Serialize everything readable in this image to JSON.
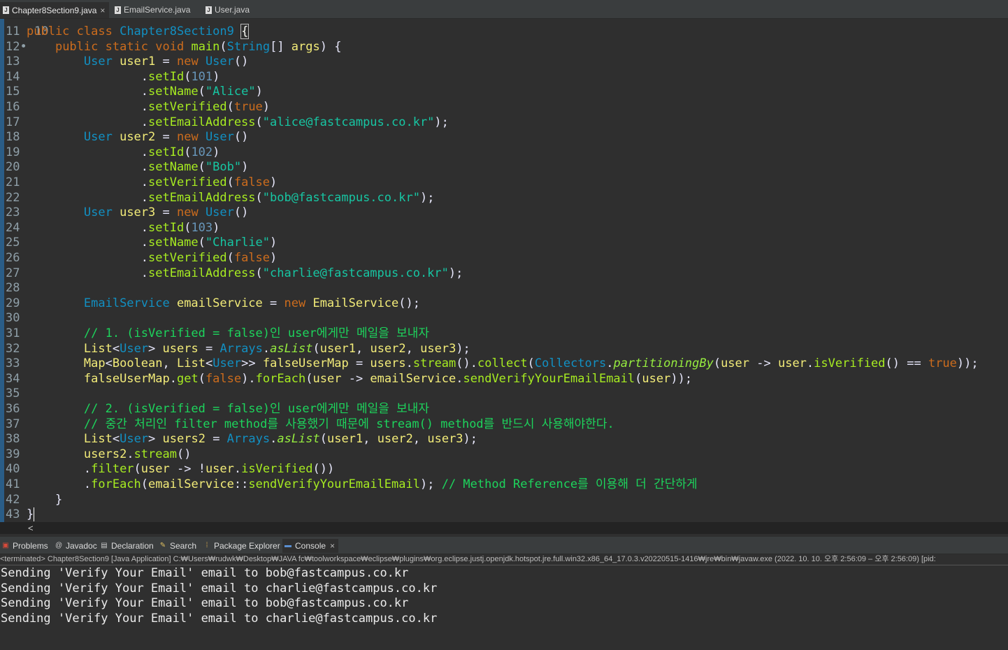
{
  "editor_tabs": [
    {
      "label": "Chapter8Section9.java",
      "active": true,
      "closable": true
    },
    {
      "label": "EmailService.java",
      "active": false
    },
    {
      "label": "User.java",
      "active": false
    }
  ],
  "editor": {
    "partial_top_line": "10",
    "lines": [
      {
        "num": "11",
        "segments": [
          [
            "k",
            "public "
          ],
          [
            "k",
            "class "
          ],
          [
            "t",
            "Chapter8Section9 "
          ],
          [
            "bracket",
            "{"
          ]
        ]
      },
      {
        "num": "12",
        "marker": "•",
        "segments": [
          [
            "p",
            "    "
          ],
          [
            "k",
            "public "
          ],
          [
            "k",
            "static "
          ],
          [
            "k",
            "void "
          ],
          [
            "m",
            "main"
          ],
          [
            "p",
            "("
          ],
          [
            "t",
            "String"
          ],
          [
            "p",
            "[] "
          ],
          [
            "v",
            "args"
          ],
          [
            "p",
            ") {"
          ]
        ]
      },
      {
        "num": "13",
        "segments": [
          [
            "p",
            "        "
          ],
          [
            "t",
            "User "
          ],
          [
            "v",
            "user1"
          ],
          [
            "p",
            " = "
          ],
          [
            "k",
            "new "
          ],
          [
            "t",
            "User"
          ],
          [
            "p",
            "()"
          ]
        ]
      },
      {
        "num": "14",
        "segments": [
          [
            "p",
            "                ."
          ],
          [
            "m",
            "setId"
          ],
          [
            "p",
            "("
          ],
          [
            "n",
            "101"
          ],
          [
            "p",
            ")"
          ]
        ]
      },
      {
        "num": "15",
        "segments": [
          [
            "p",
            "                ."
          ],
          [
            "m",
            "setName"
          ],
          [
            "p",
            "("
          ],
          [
            "s",
            "\"Alice\""
          ],
          [
            "p",
            ")"
          ]
        ]
      },
      {
        "num": "16",
        "segments": [
          [
            "p",
            "                ."
          ],
          [
            "m",
            "setVerified"
          ],
          [
            "p",
            "("
          ],
          [
            "k",
            "true"
          ],
          [
            "p",
            ")"
          ]
        ]
      },
      {
        "num": "17",
        "segments": [
          [
            "p",
            "                ."
          ],
          [
            "m",
            "setEmailAddress"
          ],
          [
            "p",
            "("
          ],
          [
            "s",
            "\"alice@fastcampus.co.kr\""
          ],
          [
            "p",
            ");"
          ]
        ]
      },
      {
        "num": "18",
        "segments": [
          [
            "p",
            "        "
          ],
          [
            "t",
            "User "
          ],
          [
            "v",
            "user2"
          ],
          [
            "p",
            " = "
          ],
          [
            "k",
            "new "
          ],
          [
            "t",
            "User"
          ],
          [
            "p",
            "()"
          ]
        ]
      },
      {
        "num": "19",
        "segments": [
          [
            "p",
            "                ."
          ],
          [
            "m",
            "setId"
          ],
          [
            "p",
            "("
          ],
          [
            "n",
            "102"
          ],
          [
            "p",
            ")"
          ]
        ]
      },
      {
        "num": "20",
        "segments": [
          [
            "p",
            "                ."
          ],
          [
            "m",
            "setName"
          ],
          [
            "p",
            "("
          ],
          [
            "s",
            "\"Bob\""
          ],
          [
            "p",
            ")"
          ]
        ]
      },
      {
        "num": "21",
        "segments": [
          [
            "p",
            "                ."
          ],
          [
            "m",
            "setVerified"
          ],
          [
            "p",
            "("
          ],
          [
            "k",
            "false"
          ],
          [
            "p",
            ")"
          ]
        ]
      },
      {
        "num": "22",
        "segments": [
          [
            "p",
            "                ."
          ],
          [
            "m",
            "setEmailAddress"
          ],
          [
            "p",
            "("
          ],
          [
            "s",
            "\"bob@fastcampus.co.kr\""
          ],
          [
            "p",
            ");"
          ]
        ]
      },
      {
        "num": "23",
        "segments": [
          [
            "p",
            "        "
          ],
          [
            "t",
            "User "
          ],
          [
            "v",
            "user3"
          ],
          [
            "p",
            " = "
          ],
          [
            "k",
            "new "
          ],
          [
            "t",
            "User"
          ],
          [
            "p",
            "()"
          ]
        ]
      },
      {
        "num": "24",
        "segments": [
          [
            "p",
            "                ."
          ],
          [
            "m",
            "setId"
          ],
          [
            "p",
            "("
          ],
          [
            "n",
            "103"
          ],
          [
            "p",
            ")"
          ]
        ]
      },
      {
        "num": "25",
        "segments": [
          [
            "p",
            "                ."
          ],
          [
            "m",
            "setName"
          ],
          [
            "p",
            "("
          ],
          [
            "s",
            "\"Charlie\""
          ],
          [
            "p",
            ")"
          ]
        ]
      },
      {
        "num": "26",
        "segments": [
          [
            "p",
            "                ."
          ],
          [
            "m",
            "setVerified"
          ],
          [
            "p",
            "("
          ],
          [
            "k",
            "false"
          ],
          [
            "p",
            ")"
          ]
        ]
      },
      {
        "num": "27",
        "segments": [
          [
            "p",
            "                ."
          ],
          [
            "m",
            "setEmailAddress"
          ],
          [
            "p",
            "("
          ],
          [
            "s",
            "\"charlie@fastcampus.co.kr\""
          ],
          [
            "p",
            ");"
          ]
        ]
      },
      {
        "num": "28",
        "segments": []
      },
      {
        "num": "29",
        "segments": [
          [
            "p",
            "        "
          ],
          [
            "t",
            "EmailService "
          ],
          [
            "v",
            "emailService"
          ],
          [
            "p",
            " = "
          ],
          [
            "k",
            "new "
          ],
          [
            "v",
            "EmailService"
          ],
          [
            "p",
            "();"
          ]
        ]
      },
      {
        "num": "30",
        "segments": []
      },
      {
        "num": "31",
        "segments": [
          [
            "p",
            "        "
          ],
          [
            "c",
            "// 1. (isVerified = false)인 user에게만 메일을 보내자"
          ]
        ]
      },
      {
        "num": "32",
        "segments": [
          [
            "p",
            "        "
          ],
          [
            "v",
            "List"
          ],
          [
            "p",
            "<"
          ],
          [
            "t",
            "User"
          ],
          [
            "p",
            "> "
          ],
          [
            "v",
            "users"
          ],
          [
            "p",
            " = "
          ],
          [
            "t",
            "Arrays"
          ],
          [
            "p",
            "."
          ],
          [
            "st",
            "asList"
          ],
          [
            "p",
            "("
          ],
          [
            "v",
            "user1"
          ],
          [
            "p",
            ", "
          ],
          [
            "v",
            "user2"
          ],
          [
            "p",
            ", "
          ],
          [
            "v",
            "user3"
          ],
          [
            "p",
            ");"
          ]
        ]
      },
      {
        "num": "33",
        "segments": [
          [
            "p",
            "        "
          ],
          [
            "v",
            "Map"
          ],
          [
            "p",
            "<"
          ],
          [
            "v",
            "Boolean"
          ],
          [
            "p",
            ", "
          ],
          [
            "v",
            "List"
          ],
          [
            "p",
            "<"
          ],
          [
            "t",
            "User"
          ],
          [
            "p",
            ">> "
          ],
          [
            "v",
            "falseUserMap"
          ],
          [
            "p",
            " = "
          ],
          [
            "v",
            "users"
          ],
          [
            "p",
            "."
          ],
          [
            "m",
            "stream"
          ],
          [
            "p",
            "()."
          ],
          [
            "m",
            "collect"
          ],
          [
            "p",
            "("
          ],
          [
            "t",
            "Collectors"
          ],
          [
            "p",
            "."
          ],
          [
            "st",
            "partitioningBy"
          ],
          [
            "p",
            "("
          ],
          [
            "v",
            "user"
          ],
          [
            "p",
            " -> "
          ],
          [
            "v",
            "user"
          ],
          [
            "p",
            "."
          ],
          [
            "m",
            "isVerified"
          ],
          [
            "p",
            "() == "
          ],
          [
            "k",
            "true"
          ],
          [
            "p",
            "));"
          ]
        ]
      },
      {
        "num": "34",
        "segments": [
          [
            "p",
            "        "
          ],
          [
            "v",
            "falseUserMap"
          ],
          [
            "p",
            "."
          ],
          [
            "m",
            "get"
          ],
          [
            "p",
            "("
          ],
          [
            "k",
            "false"
          ],
          [
            "p",
            ")."
          ],
          [
            "m",
            "forEach"
          ],
          [
            "p",
            "("
          ],
          [
            "v",
            "user"
          ],
          [
            "p",
            " -> "
          ],
          [
            "v",
            "emailService"
          ],
          [
            "p",
            "."
          ],
          [
            "m",
            "sendVerifyYourEmailEmail"
          ],
          [
            "p",
            "("
          ],
          [
            "v",
            "user"
          ],
          [
            "p",
            "));"
          ]
        ]
      },
      {
        "num": "35",
        "segments": []
      },
      {
        "num": "36",
        "segments": [
          [
            "p",
            "        "
          ],
          [
            "c",
            "// 2. (isVerified = false)인 user에게만 메일을 보내자"
          ]
        ]
      },
      {
        "num": "37",
        "segments": [
          [
            "p",
            "        "
          ],
          [
            "c",
            "// 중간 처리인 filter method를 사용했기 때문에 stream() method를 반드시 사용해야한다."
          ]
        ]
      },
      {
        "num": "38",
        "segments": [
          [
            "p",
            "        "
          ],
          [
            "v",
            "List"
          ],
          [
            "p",
            "<"
          ],
          [
            "t",
            "User"
          ],
          [
            "p",
            "> "
          ],
          [
            "v",
            "users2"
          ],
          [
            "p",
            " = "
          ],
          [
            "t",
            "Arrays"
          ],
          [
            "p",
            "."
          ],
          [
            "st",
            "asList"
          ],
          [
            "p",
            "("
          ],
          [
            "v",
            "user1"
          ],
          [
            "p",
            ", "
          ],
          [
            "v",
            "user2"
          ],
          [
            "p",
            ", "
          ],
          [
            "v",
            "user3"
          ],
          [
            "p",
            ");"
          ]
        ]
      },
      {
        "num": "39",
        "segments": [
          [
            "p",
            "        "
          ],
          [
            "v",
            "users2"
          ],
          [
            "p",
            "."
          ],
          [
            "m",
            "stream"
          ],
          [
            "p",
            "()"
          ]
        ]
      },
      {
        "num": "40",
        "segments": [
          [
            "p",
            "        ."
          ],
          [
            "m",
            "filter"
          ],
          [
            "p",
            "("
          ],
          [
            "v",
            "user"
          ],
          [
            "p",
            " -> !"
          ],
          [
            "v",
            "user"
          ],
          [
            "p",
            "."
          ],
          [
            "m",
            "isVerified"
          ],
          [
            "p",
            "())"
          ]
        ]
      },
      {
        "num": "41",
        "segments": [
          [
            "p",
            "        ."
          ],
          [
            "m",
            "forEach"
          ],
          [
            "p",
            "("
          ],
          [
            "v",
            "emailService"
          ],
          [
            "p",
            "::"
          ],
          [
            "m",
            "sendVerifyYourEmailEmail"
          ],
          [
            "p",
            "); "
          ],
          [
            "c",
            "// Method Reference를 이용해 더 간단하게"
          ]
        ]
      },
      {
        "num": "42",
        "segments": [
          [
            "p",
            "    }"
          ]
        ]
      },
      {
        "num": "43",
        "segments": [
          [
            "p",
            "}"
          ],
          [
            "caret",
            ""
          ]
        ]
      }
    ]
  },
  "hscroll_arrow": "<",
  "view_tabs": [
    {
      "label": "Problems",
      "icon": "problems-icon",
      "glyph": "▣",
      "color": "#d94a3a"
    },
    {
      "label": "Javadoc",
      "icon": "javadoc-icon",
      "glyph": "@",
      "color": "#c9c9c9"
    },
    {
      "label": "Declaration",
      "icon": "declaration-icon",
      "glyph": "▤",
      "color": "#c9c9c9"
    },
    {
      "label": "Search",
      "icon": "search-icon",
      "glyph": "✎",
      "color": "#e0c060"
    },
    {
      "label": "Package Explorer",
      "icon": "package-explorer-icon",
      "glyph": "⁞",
      "color": "#e0b050"
    },
    {
      "label": "Console",
      "icon": "console-icon",
      "glyph": "▬",
      "color": "#5a8fd0",
      "active": true,
      "closable": true
    }
  ],
  "console": {
    "status": "<terminated> Chapter8Section9 [Java Application] C:₩Users₩rudwk₩Desktop₩JAVA fc₩toolworkspace₩eclipse₩plugins₩org.eclipse.justj.openjdk.hotspot.jre.full.win32.x86_64_17.0.3.v20220515-1416₩jre₩bin₩javaw.exe  (2022. 10. 10. 오후 2:56:09 – 오후 2:56:09) [pid:",
    "output": [
      "Sending 'Verify Your Email' email to bob@fastcampus.co.kr",
      "Sending 'Verify Your Email' email to charlie@fastcampus.co.kr",
      "Sending 'Verify Your Email' email to bob@fastcampus.co.kr",
      "Sending 'Verify Your Email' email to charlie@fastcampus.co.kr"
    ]
  }
}
